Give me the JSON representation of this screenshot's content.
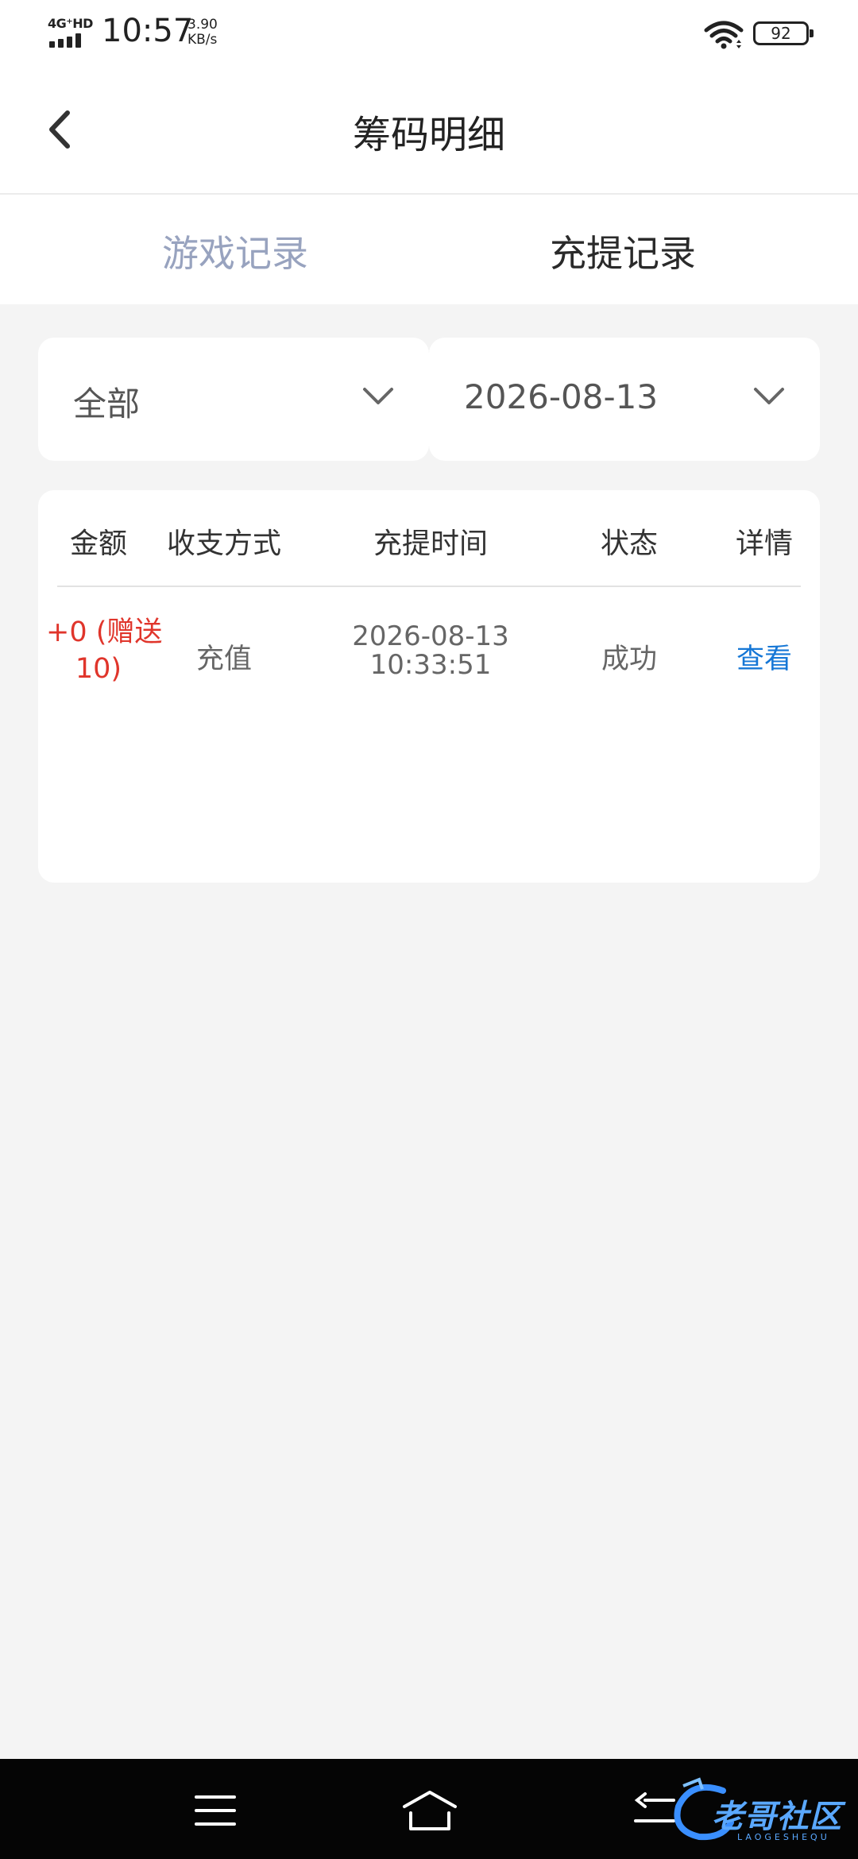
{
  "status_bar": {
    "network": "4G⁺HD",
    "time": "10:57",
    "speed_value": "3.90",
    "speed_unit": "KB/s",
    "battery": "92"
  },
  "header": {
    "title": "筹码明细",
    "back_icon": "chevron-left-icon"
  },
  "tabs": [
    {
      "label": "游戏记录",
      "active": false
    },
    {
      "label": "充提记录",
      "active": true
    }
  ],
  "filters": {
    "type_value": "全部",
    "date_value": "2026-08-13"
  },
  "table": {
    "headers": [
      "金额",
      "收支方式",
      "充提时间",
      "状态",
      "详情"
    ],
    "rows": [
      {
        "amount_line1": "+0 (赠送",
        "amount_line2": "10)",
        "method": "充值",
        "date": "2026-08-13",
        "time": "10:33:51",
        "status": "成功",
        "detail": "查看"
      }
    ]
  },
  "nav": {
    "menu_icon": "menu-icon",
    "home_icon": "home-icon",
    "back_icon": "back-icon"
  },
  "watermark": {
    "text": "老哥社区",
    "sub": "LAOGESHEQU"
  },
  "colors": {
    "accent_red": "#e0352b",
    "link_blue": "#1677d6",
    "inactive_tab": "#98a3bf",
    "page_bg": "#f4f4f4"
  }
}
